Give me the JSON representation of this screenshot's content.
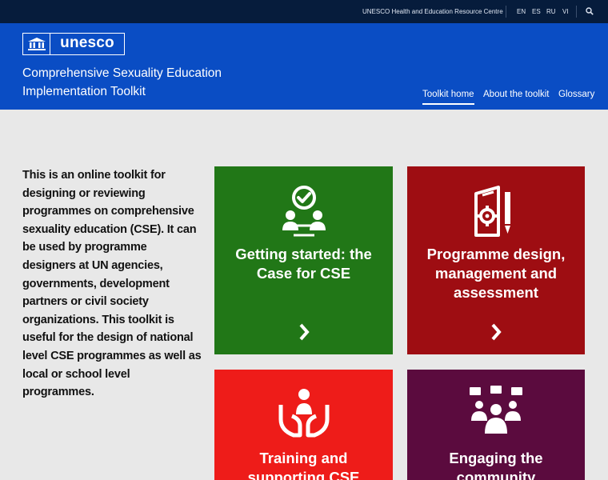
{
  "topbar": {
    "resource_centre": "UNESCO Health and Education Resource Centre",
    "languages": [
      "EN",
      "ES",
      "RU",
      "VI"
    ]
  },
  "header": {
    "logo_text": "unesco",
    "title_line1": "Comprehensive Sexuality Education",
    "title_line2": "Implementation Toolkit",
    "nav": [
      {
        "label": "Toolkit home",
        "active": true
      },
      {
        "label": "About the toolkit",
        "active": false
      },
      {
        "label": "Glossary",
        "active": false
      }
    ]
  },
  "intro": {
    "text": "This is an online toolkit for designing or reviewing programmes on comprehensive sexuality education (CSE). It can be used by programme designers at UN agencies, governments, development partners or civil society organizations. This toolkit is useful for the design of national level CSE programmes as well as local or school level programmes."
  },
  "cards": [
    {
      "title_line1": "Getting started: the",
      "title_line2": "Case for CSE",
      "title_line3": "",
      "color": "#217717",
      "icon": "people-check-icon"
    },
    {
      "title_line1": "Programme design,",
      "title_line2": "management and",
      "title_line3": "assessment",
      "color": "#9e0d12",
      "icon": "document-gear-icon"
    },
    {
      "title_line1": "Training and",
      "title_line2": "supporting CSE",
      "title_line3": "",
      "color": "#ee1c19",
      "icon": "hands-person-icon"
    },
    {
      "title_line1": "Engaging the",
      "title_line2": "community",
      "title_line3": "",
      "color": "#5b0b3e",
      "icon": "group-chat-icon"
    }
  ],
  "colors": {
    "topbar": "#061c3c",
    "header": "#0a4dc4",
    "background": "#e8e8e8"
  }
}
